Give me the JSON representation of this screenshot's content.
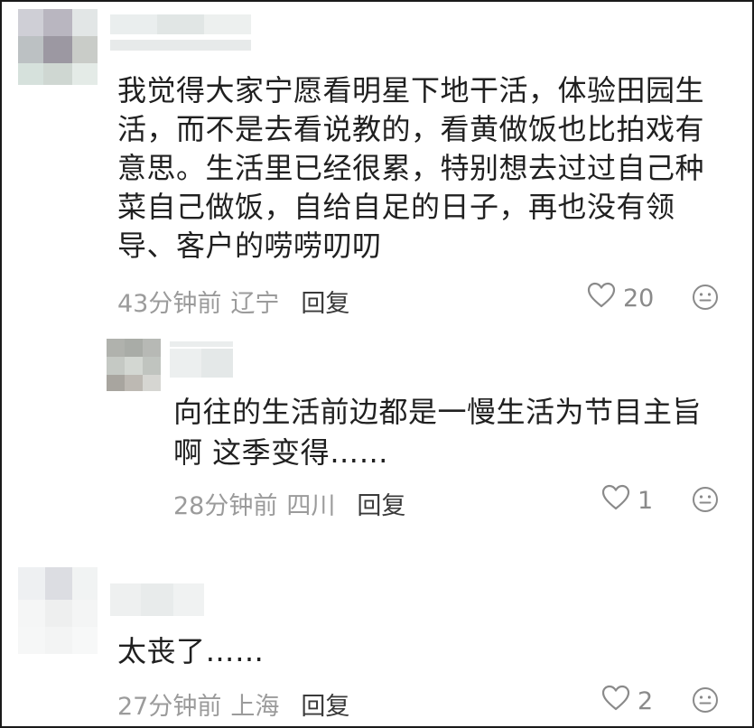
{
  "comments": [
    {
      "text": "我觉得大家宁愿看明星下地干活，体验田园生活，而不是去看说教的，看黄做饭也比拍戏有意思。生活里已经很累，特别想去过过自己种菜自己做饭，自给自足的日子，再也没有领导、客户的唠唠叨叨",
      "time": "43分钟前",
      "location": "辽宁",
      "reply_label": "回复",
      "likes": "20"
    },
    {
      "text": "向往的生活前边都是一慢生活为节目主旨啊 这季变得……",
      "time": "28分钟前",
      "location": "四川",
      "reply_label": "回复",
      "likes": "1"
    },
    {
      "text": "太丧了……",
      "time": "27分钟前",
      "location": "上海",
      "reply_label": "回复",
      "likes": "2"
    }
  ],
  "icons": {
    "like": "heart-outline-icon",
    "emoji": "smiley-face-icon"
  },
  "colors": {
    "text": "#202020",
    "meta": "#9b9b9b",
    "reply": "#3a3a3a",
    "border": "#1a1a1a"
  }
}
